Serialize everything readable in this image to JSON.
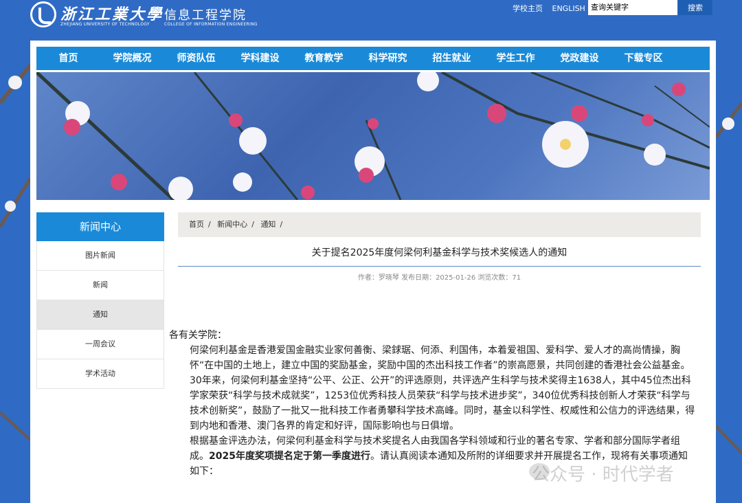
{
  "header": {
    "logo_cn": "浙江工業大學",
    "logo_college_cn": "信息工程学院",
    "logo_en": "ZHEJIANG UNIVERSITY OF TECHNOLOGY",
    "logo_college_en": "COLLEGE OF INFORMATION ENGINEERING",
    "link_home": "学校主页",
    "link_english": "ENGLISH",
    "search_placeholder": "查询关键字",
    "search_button": "搜索"
  },
  "nav": [
    "首页",
    "学院概况",
    "师资队伍",
    "学科建设",
    "教育教学",
    "科学研究",
    "招生就业",
    "学生工作",
    "党政建设",
    "下载专区"
  ],
  "sidebar": {
    "heading": "新闻中心",
    "items": [
      "图片新闻",
      "新闻",
      "通知",
      "一周会议",
      "学术活动"
    ],
    "active": "通知"
  },
  "breadcrumb": [
    "首页",
    "新闻中心",
    "通知"
  ],
  "article": {
    "title": "关于提名2025年度何梁何利基金科学与技术奖候选人的通知",
    "meta": "作者：罗晓琴 发布日期：2025-01-26 浏览次数：71",
    "salutation": "各有关学院：",
    "para1": "何梁何利基金是香港爱国金融实业家何善衡、梁銶琚、何添、利国伟，本着爱祖国、爱科学、爱人才的高尚情操，胸怀“在中国的土地上，建立中国的奖励基金，奖励中国的杰出科技工作者”的崇高愿景，共同创建的香港社会公益基金。30年来，何梁何利基金坚持“公平、公正、公开”的评选原则，共评选产生科学与技术奖得主1638人，其中45位杰出科学家荣获“科学与技术成就奖”，1253位优秀科技人员荣获“科学与技术进步奖”，340位优秀科技创新人才荣获“科学与技术创新奖”，鼓励了一批又一批科技工作者勇攀科学技术高峰。同时，基金以科学性、权威性和公信力的评选结果，得到内地和香港、澳门各界的肯定和好评，国际影响也与日俱增。",
    "para2_a": "根据基金评选办法，何梁何利基金科学与技术奖提名人由我国各学科领域和行业的著名专家、学者和部分国际学者组成。",
    "para2_bold": "2025年度奖项提名定于第一季度进行",
    "para2_b": "。请认真阅读本通知及所附的详细要求并开展提名工作，现将有关事项通知如下："
  },
  "watermark": "公众号 · 时代学者"
}
